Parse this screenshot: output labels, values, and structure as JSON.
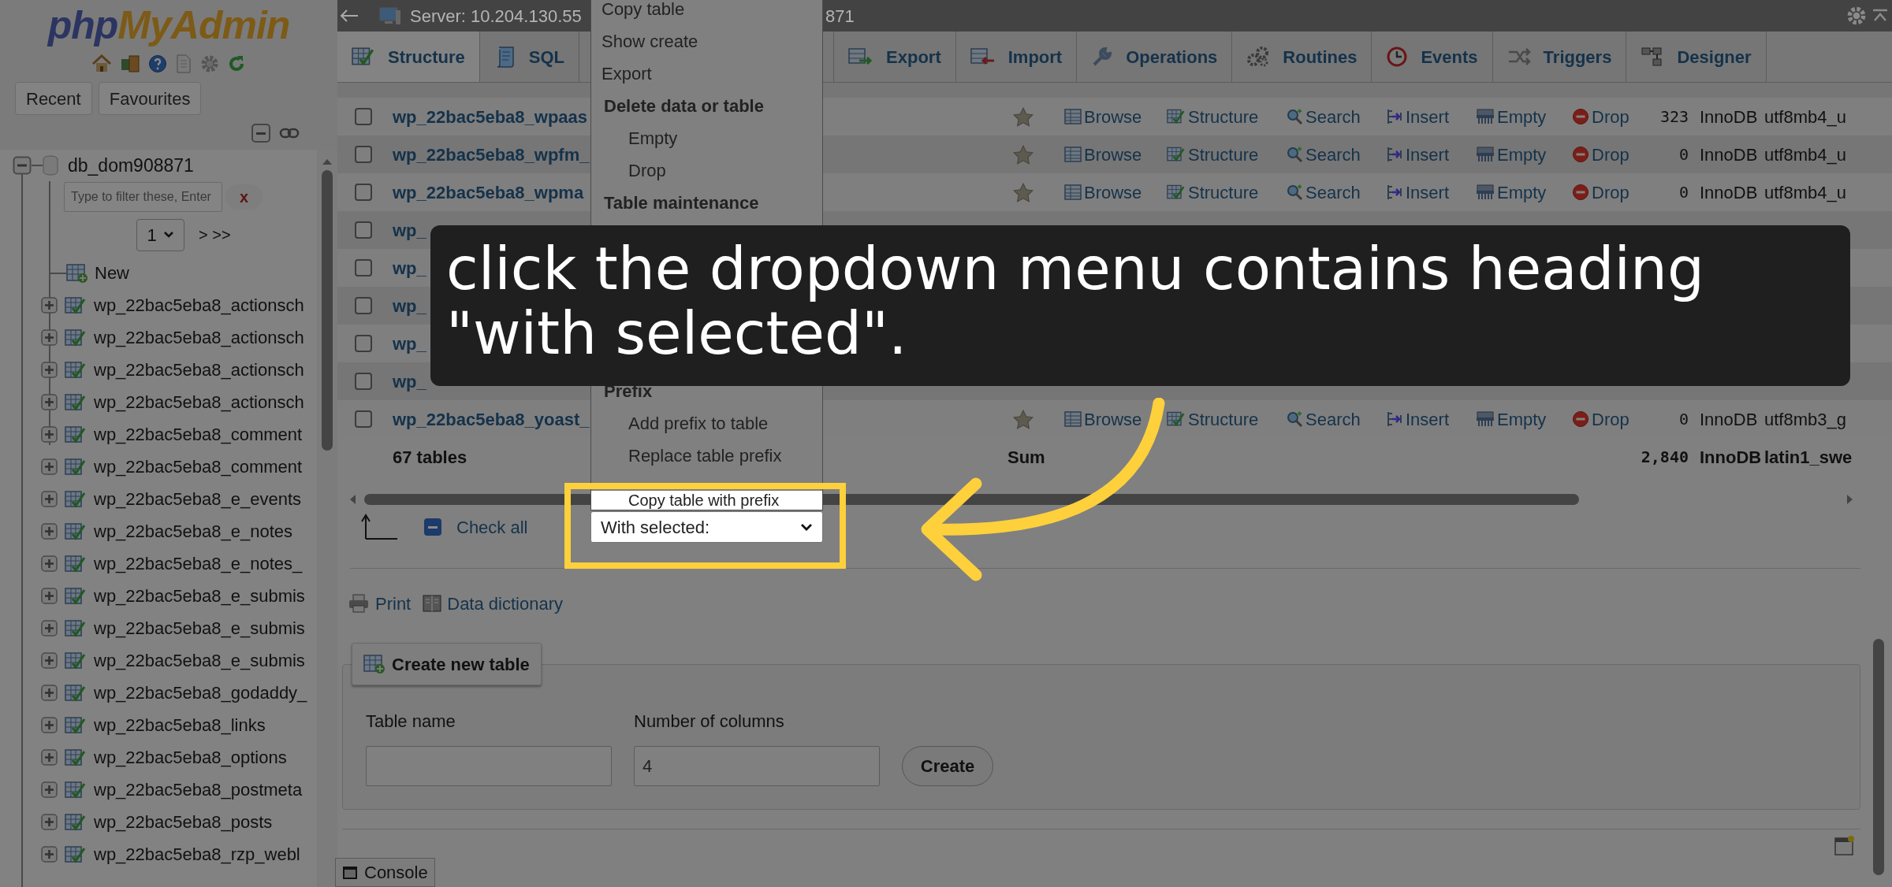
{
  "sidebar": {
    "logo": {
      "text_1": "php",
      "text_2": "MyAdmin"
    },
    "buttons": [
      {
        "label": "Recent"
      },
      {
        "label": "Favourites"
      }
    ],
    "tree": {
      "database": "db_dom908871",
      "expanded": true,
      "filter_placeholder": "Type to filter these, Enter",
      "clear_label": "x",
      "page": "1",
      "page_next": "> >>",
      "children": [
        {
          "label": "New",
          "kind": "new"
        },
        {
          "label": "wp_22bac5eba8_actionsch",
          "kind": "table",
          "expanded": false
        },
        {
          "label": "wp_22bac5eba8_actionsch",
          "kind": "table",
          "expanded": false
        },
        {
          "label": "wp_22bac5eba8_actionsch",
          "kind": "table",
          "expanded": false
        },
        {
          "label": "wp_22bac5eba8_actionsch",
          "kind": "table",
          "expanded": false
        },
        {
          "label": "wp_22bac5eba8_comment",
          "kind": "table",
          "expanded": false
        },
        {
          "label": "wp_22bac5eba8_comment",
          "kind": "table",
          "expanded": false
        },
        {
          "label": "wp_22bac5eba8_e_events",
          "kind": "table",
          "expanded": false
        },
        {
          "label": "wp_22bac5eba8_e_notes",
          "kind": "table",
          "expanded": false
        },
        {
          "label": "wp_22bac5eba8_e_notes_",
          "kind": "table",
          "expanded": false
        },
        {
          "label": "wp_22bac5eba8_e_submis",
          "kind": "table",
          "expanded": false
        },
        {
          "label": "wp_22bac5eba8_e_submis",
          "kind": "table",
          "expanded": false
        },
        {
          "label": "wp_22bac5eba8_e_submis",
          "kind": "table",
          "expanded": false
        },
        {
          "label": "wp_22bac5eba8_godaddy_",
          "kind": "table",
          "expanded": false
        },
        {
          "label": "wp_22bac5eba8_links",
          "kind": "table",
          "expanded": false
        },
        {
          "label": "wp_22bac5eba8_options",
          "kind": "table",
          "expanded": false
        },
        {
          "label": "wp_22bac5eba8_postmeta",
          "kind": "table",
          "expanded": false
        },
        {
          "label": "wp_22bac5eba8_posts",
          "kind": "table",
          "expanded": false
        },
        {
          "label": "wp_22bac5eba8_rzp_webl",
          "kind": "table",
          "expanded": false
        }
      ]
    }
  },
  "top_bar": {
    "server": "Server: 10.204.130.55",
    "database_tail": "871"
  },
  "tabs": [
    {
      "label": "Structure",
      "selected": true
    },
    {
      "label": "SQL",
      "selected": false
    },
    {
      "label": "Export",
      "selected": false
    },
    {
      "label": "Import",
      "selected": false
    },
    {
      "label": "Operations",
      "selected": false
    },
    {
      "label": "Routines",
      "selected": false
    },
    {
      "label": "Events",
      "selected": false
    },
    {
      "label": "Triggers",
      "selected": false
    },
    {
      "label": "Designer",
      "selected": false
    }
  ],
  "menu": {
    "sections": [
      {
        "items": [
          {
            "label": "Copy table",
            "spotlit": false
          },
          {
            "label": "Show create",
            "spotlit": false
          },
          {
            "label": "Export",
            "spotlit": false
          }
        ]
      },
      {
        "heading": "Delete data or table",
        "items": [
          {
            "label": "Empty",
            "spotlit": false
          },
          {
            "label": "Drop",
            "spotlit": false
          }
        ]
      },
      {
        "heading": "Table maintenance"
      },
      {
        "heading": "Prefix",
        "items": [
          {
            "label": "Add prefix to table",
            "spotlit": false
          },
          {
            "label": "Replace table prefix",
            "spotlit": false
          },
          {
            "label": "Copy table with prefix",
            "spotlit": true
          }
        ]
      }
    ]
  },
  "table": {
    "rows": [
      {
        "kind": "full",
        "name": "wp_22bac5eba8_wpaas",
        "checked": false,
        "actions": [
          "Browse",
          "Structure",
          "Search",
          "Insert",
          "Empty",
          "Drop"
        ],
        "rows_count": "323",
        "engine": "InnoDB",
        "collation": "utf8mb4_u"
      },
      {
        "kind": "full",
        "name": "wp_22bac5eba8_wpfm_",
        "checked": false,
        "actions": [
          "Browse",
          "Structure",
          "Search",
          "Insert",
          "Empty",
          "Drop"
        ],
        "rows_count": "0",
        "engine": "InnoDB",
        "collation": "utf8mb4_u"
      },
      {
        "kind": "full",
        "name": "wp_22bac5eba8_wpma",
        "checked": false,
        "actions": [
          "Browse",
          "Structure",
          "Search",
          "Insert",
          "Empty",
          "Drop"
        ],
        "rows_count": "0",
        "engine": "InnoDB",
        "collation": "utf8mb4_u"
      },
      {
        "kind": "covered",
        "name": "wp_",
        "checked": false
      },
      {
        "kind": "covered",
        "name": "wp_",
        "checked": false
      },
      {
        "kind": "covered",
        "name": "wp_",
        "checked": false
      },
      {
        "kind": "covered",
        "name": "wp_",
        "checked": false
      },
      {
        "kind": "covered",
        "name": "wp_",
        "checked": false
      },
      {
        "kind": "full",
        "name": "wp_22bac5eba8_yoast_",
        "checked": false,
        "actions": [
          "Browse",
          "Structure",
          "Search",
          "Insert",
          "Empty",
          "Drop"
        ],
        "rows_count": "0",
        "engine": "InnoDB",
        "collation": "utf8mb3_g"
      }
    ],
    "footer": {
      "count": "67 tables",
      "sum": "Sum",
      "total": "2,840",
      "engine": "InnoDB",
      "collation": "latin1_swe"
    }
  },
  "check_all": {
    "label": "Check all",
    "indeterminate": true
  },
  "with_selected": "With selected:",
  "links": [
    "Print",
    "Data dictionary"
  ],
  "create_table": {
    "legend": "Create new table",
    "fields": [
      {
        "label": "Table name"
      },
      {
        "label": "Number of columns",
        "value": "4"
      }
    ],
    "button": "Create"
  },
  "console": "Console",
  "banner": {
    "text": "click the dropdown menu contains heading \"with selected\"."
  }
}
